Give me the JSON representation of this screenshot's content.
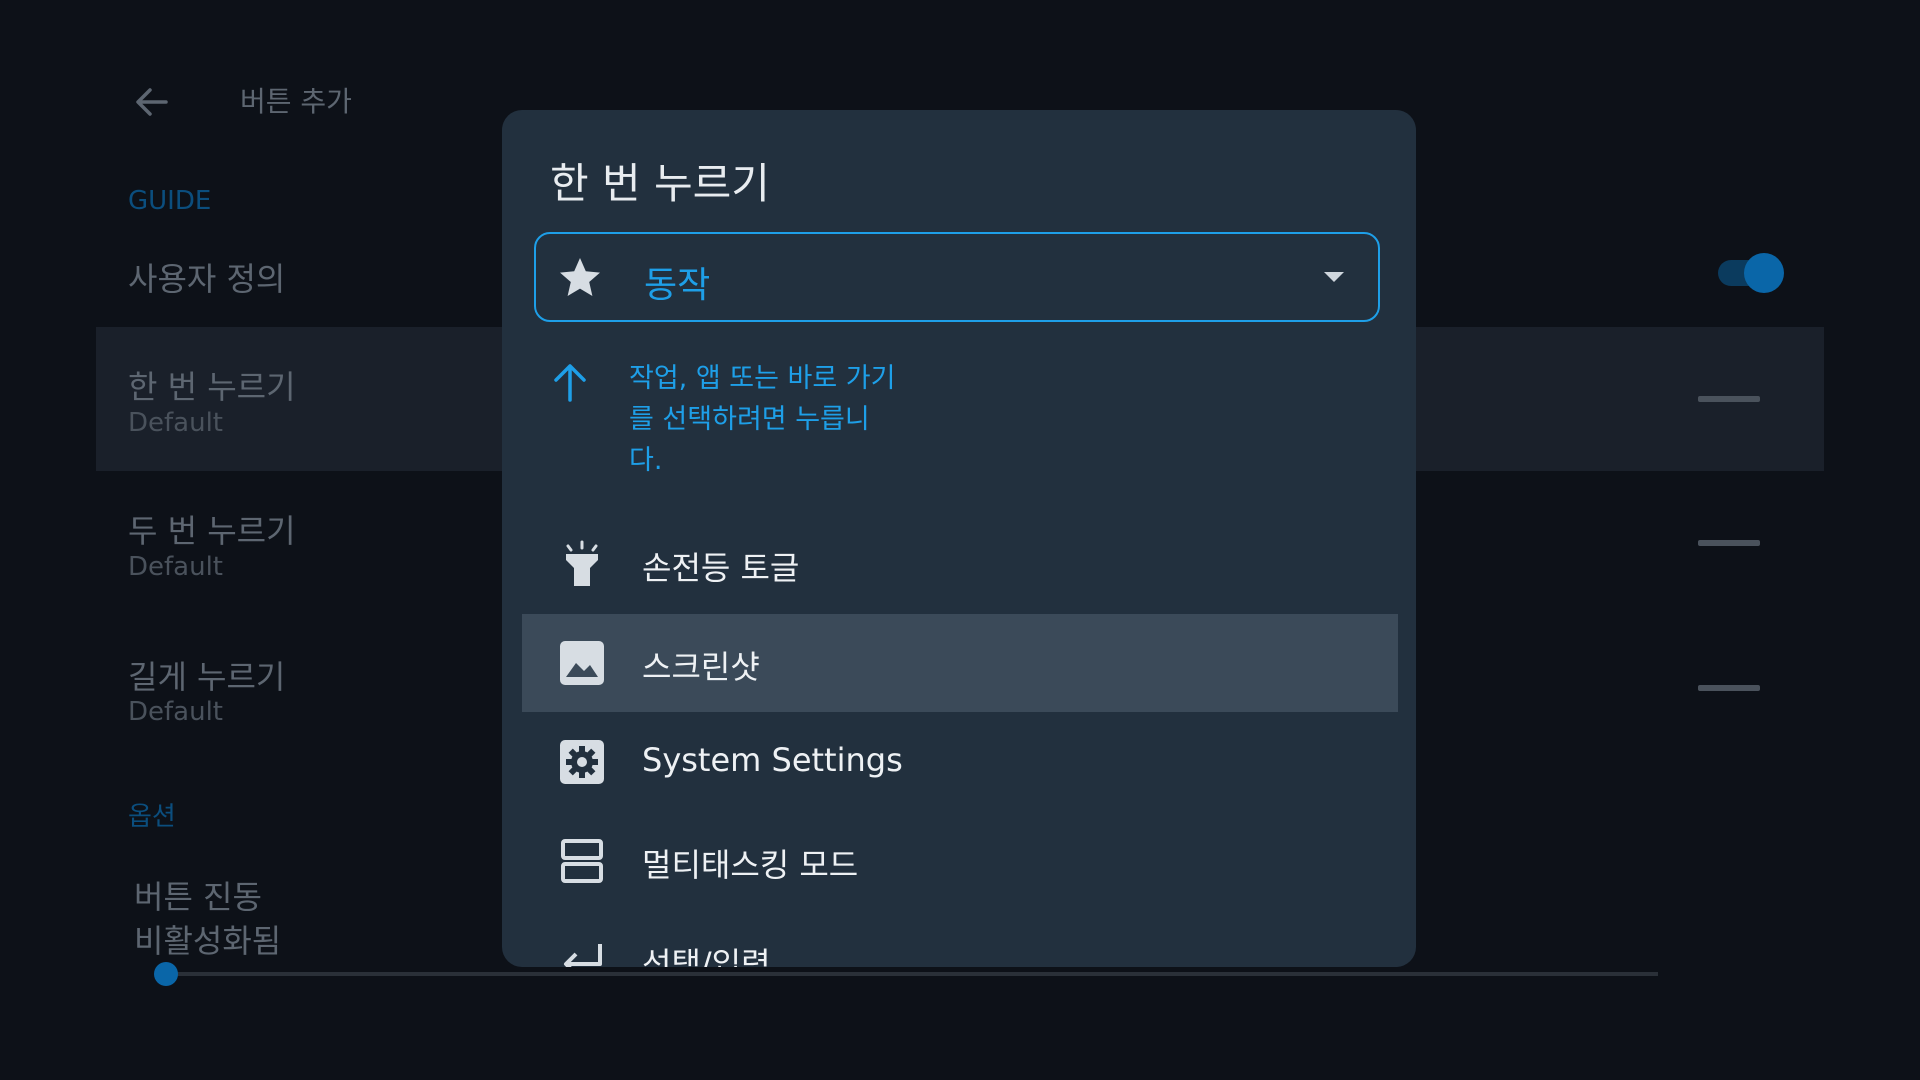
{
  "header": {
    "back_icon": "arrow-left-icon",
    "title": "버튼 추가"
  },
  "sections": {
    "guide_label": "GUIDE",
    "options_label": "옵션"
  },
  "settings": {
    "custom": {
      "title": "사용자 정의",
      "toggle_on": true
    },
    "single_press": {
      "title": "한 번 누르기",
      "subtitle": "Default"
    },
    "double_press": {
      "title": "두 번 누르기",
      "subtitle": "Default"
    },
    "long_press": {
      "title": "길게 누르기",
      "subtitle": "Default"
    },
    "vibration": {
      "title": "버튼 진동",
      "subtitle": "비활성화됨",
      "level": 0
    }
  },
  "dialog": {
    "title": "한 번 누르기",
    "dropdown": {
      "icon": "star-icon",
      "value": "동작"
    },
    "hint": {
      "icon": "arrow-up-icon",
      "text": "작업, 앱 또는 바로 가기를 선택하려면 누릅니다."
    },
    "options": [
      {
        "icon": "flashlight-icon",
        "label": "손전등 토글",
        "selected": false
      },
      {
        "icon": "image-icon",
        "label": "스크린샷",
        "selected": true
      },
      {
        "icon": "gear-icon",
        "label": "System Settings",
        "selected": false
      },
      {
        "icon": "split-screen-icon",
        "label": "멀티태스킹 모드",
        "selected": false
      },
      {
        "icon": "enter-icon",
        "label": "선택/입력",
        "selected": false
      }
    ]
  },
  "colors": {
    "accent": "#1e9fe8",
    "dialog_bg": "#22303e",
    "page_bg": "#0d1118",
    "selected_bg": "#3b4a59"
  }
}
